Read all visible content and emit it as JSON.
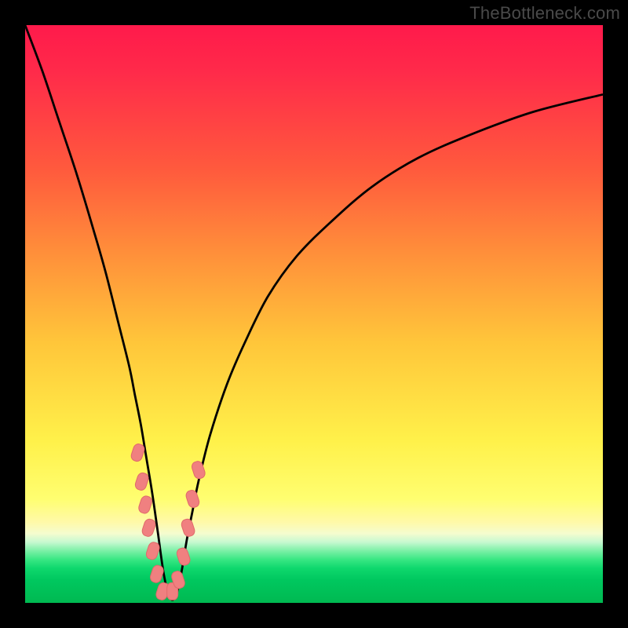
{
  "watermark": {
    "text": "TheBottleneck.com"
  },
  "colors": {
    "frame": "#000000",
    "curve": "#000000",
    "marker_fill": "#f08080",
    "marker_stroke": "#e06a6a",
    "gradient_top": "#ff1a4b",
    "gradient_bottom": "#00b951"
  },
  "chart_data": {
    "type": "line",
    "title": "",
    "xlabel": "",
    "ylabel": "",
    "xlim": [
      0,
      100
    ],
    "ylim": [
      0,
      100
    ],
    "note": "Axes are unlabeled; values are percentages of the plot area (0..100 from bottom-left). Curve shows a V-shaped bottleneck dip; minimum ≈ x=24, y≈1.",
    "series": [
      {
        "name": "bottleneck-curve",
        "x": [
          0,
          3,
          6,
          9,
          12,
          14,
          16,
          18,
          19,
          20,
          21,
          22,
          23,
          24,
          25,
          26,
          27,
          28,
          29,
          30,
          32,
          35,
          38,
          42,
          47,
          53,
          60,
          68,
          77,
          88,
          100
        ],
        "y": [
          100,
          92,
          83,
          74,
          64,
          57,
          49,
          41,
          36,
          31,
          25,
          19,
          12,
          5,
          1,
          1,
          5,
          11,
          16,
          21,
          29,
          38,
          45,
          53,
          60,
          66,
          72,
          77,
          81,
          85,
          88
        ]
      }
    ],
    "markers": {
      "name": "highlight-beads",
      "shape": "rounded-rect",
      "points": [
        {
          "x": 19.5,
          "y": 26
        },
        {
          "x": 20.2,
          "y": 21
        },
        {
          "x": 20.8,
          "y": 17
        },
        {
          "x": 21.4,
          "y": 13
        },
        {
          "x": 22.1,
          "y": 9
        },
        {
          "x": 22.8,
          "y": 5
        },
        {
          "x": 23.8,
          "y": 2
        },
        {
          "x": 25.5,
          "y": 2
        },
        {
          "x": 26.5,
          "y": 4
        },
        {
          "x": 27.4,
          "y": 8
        },
        {
          "x": 28.2,
          "y": 13
        },
        {
          "x": 29.0,
          "y": 18
        },
        {
          "x": 30.0,
          "y": 23
        }
      ]
    }
  }
}
